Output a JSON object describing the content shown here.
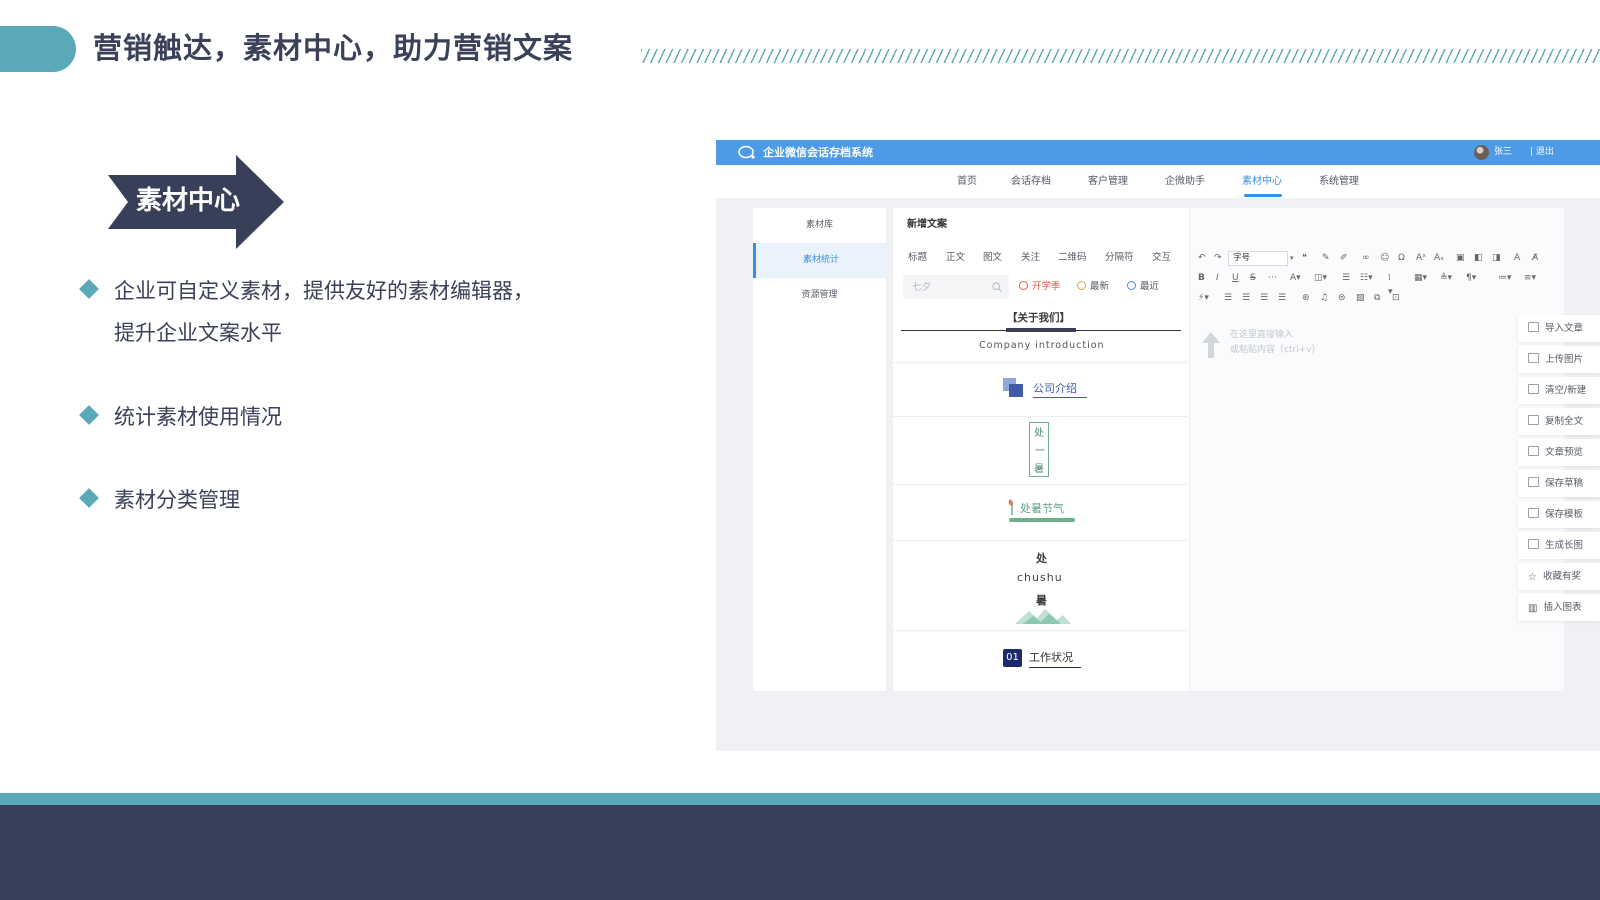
{
  "slide": {
    "title": "营销触达，素材中心，助力营销文案",
    "badge": "素材中心",
    "bullets": [
      {
        "line1": "企业可自定义素材，提供友好的素材编辑器，",
        "line2": "提升企业文案水平"
      },
      {
        "line1": "统计素材使用情况"
      },
      {
        "line1": "素材分类管理"
      }
    ],
    "colors": {
      "accent": "#5aa9b8",
      "navy": "#384059",
      "text": "#3a4159",
      "app_blue": "#4d9be6"
    }
  },
  "app": {
    "title": "企业微信会话存档系统",
    "user": "张三",
    "logout": "| 退出",
    "nav": [
      "首页",
      "会话存档",
      "客户管理",
      "企微助手",
      "素材中心",
      "系统管理"
    ],
    "nav_active": "素材中心",
    "sidebar": [
      "素材库",
      "素材统计",
      "资源管理"
    ],
    "sidebar_active": "素材统计",
    "main_title": "新增文案",
    "categories": [
      "标题",
      "正文",
      "图文",
      "关注",
      "二维码",
      "分隔符",
      "交互"
    ],
    "search_placeholder": "七夕",
    "filters": [
      {
        "label": "开学季",
        "color": "#e8584f"
      },
      {
        "label": "最新",
        "color": "#e6a23c"
      },
      {
        "label": "最近",
        "color": "#3b8ee0"
      }
    ],
    "templates": {
      "about_cn": "【关于我们】",
      "about_en": "Company introduction",
      "company": "公司介绍",
      "vertical": [
        "处",
        "一",
        "暑"
      ],
      "festival": "处暑节气",
      "chushu_top": "处",
      "chushu_mid": "chushu",
      "chushu_bot": "暑",
      "num": "01",
      "work": "工作状况"
    },
    "editor": {
      "font_select": "字号",
      "paste_hint_1": "在这里直接输入",
      "paste_hint_2": "或粘贴内容（ctrl+v）"
    },
    "actions": [
      "导入文章",
      "上传图片",
      "清空/新建",
      "复制全文",
      "文章预览",
      "保存草稿",
      "保存模板",
      "生成长图",
      "收藏有奖",
      "插入图表"
    ]
  }
}
